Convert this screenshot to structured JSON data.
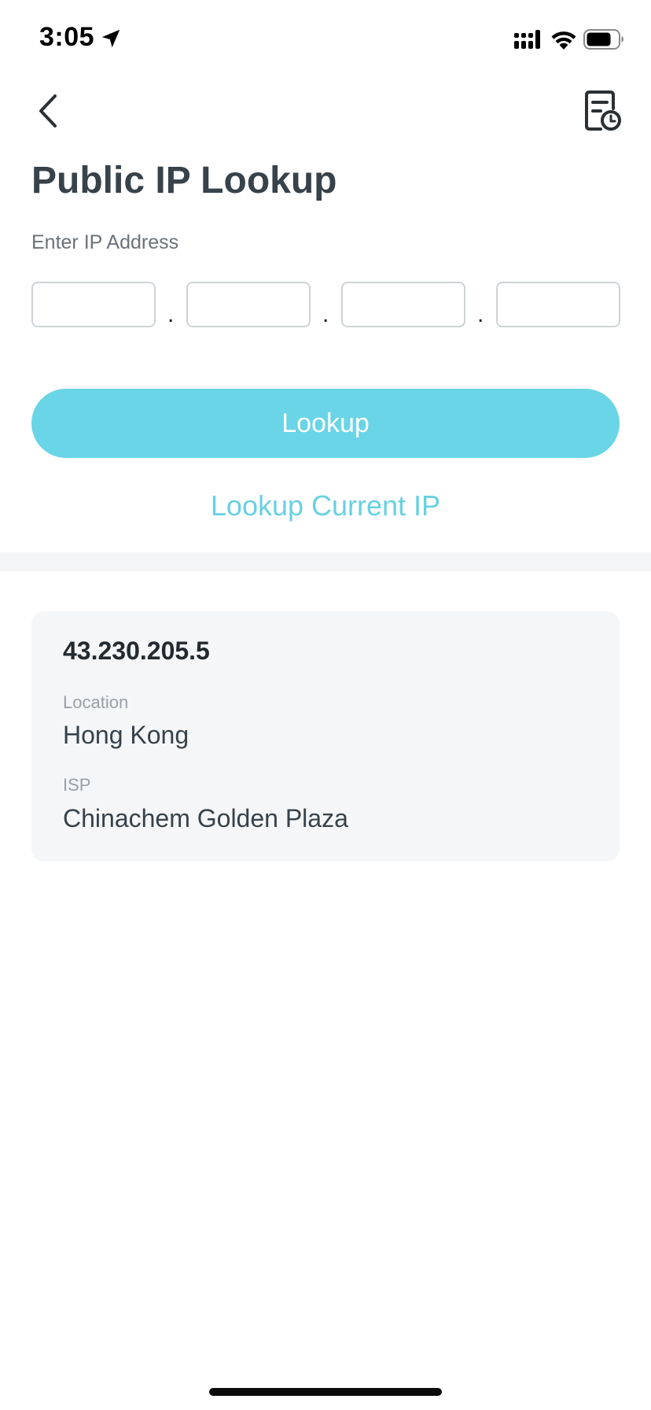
{
  "status_bar": {
    "time": "3:05"
  },
  "header": {
    "title": "Public IP Lookup"
  },
  "form": {
    "label": "Enter IP Address",
    "octets": [
      "",
      "",
      "",
      ""
    ],
    "separator": ".",
    "lookup_label": "Lookup",
    "lookup_current_label": "Lookup Current IP"
  },
  "result": {
    "ip": "43.230.205.5",
    "location_label": "Location",
    "location_value": "Hong Kong",
    "isp_label": "ISP",
    "isp_value": "Chinachem Golden Plaza"
  },
  "colors": {
    "accent": "#69d5e6",
    "title": "#37424a",
    "card_bg": "#f5f6f8"
  },
  "icons": {
    "status": [
      "location-arrow-icon",
      "cellular-signal-icon",
      "wifi-icon",
      "battery-icon"
    ],
    "header": [
      "chevron-left-icon",
      "history-document-icon"
    ]
  }
}
